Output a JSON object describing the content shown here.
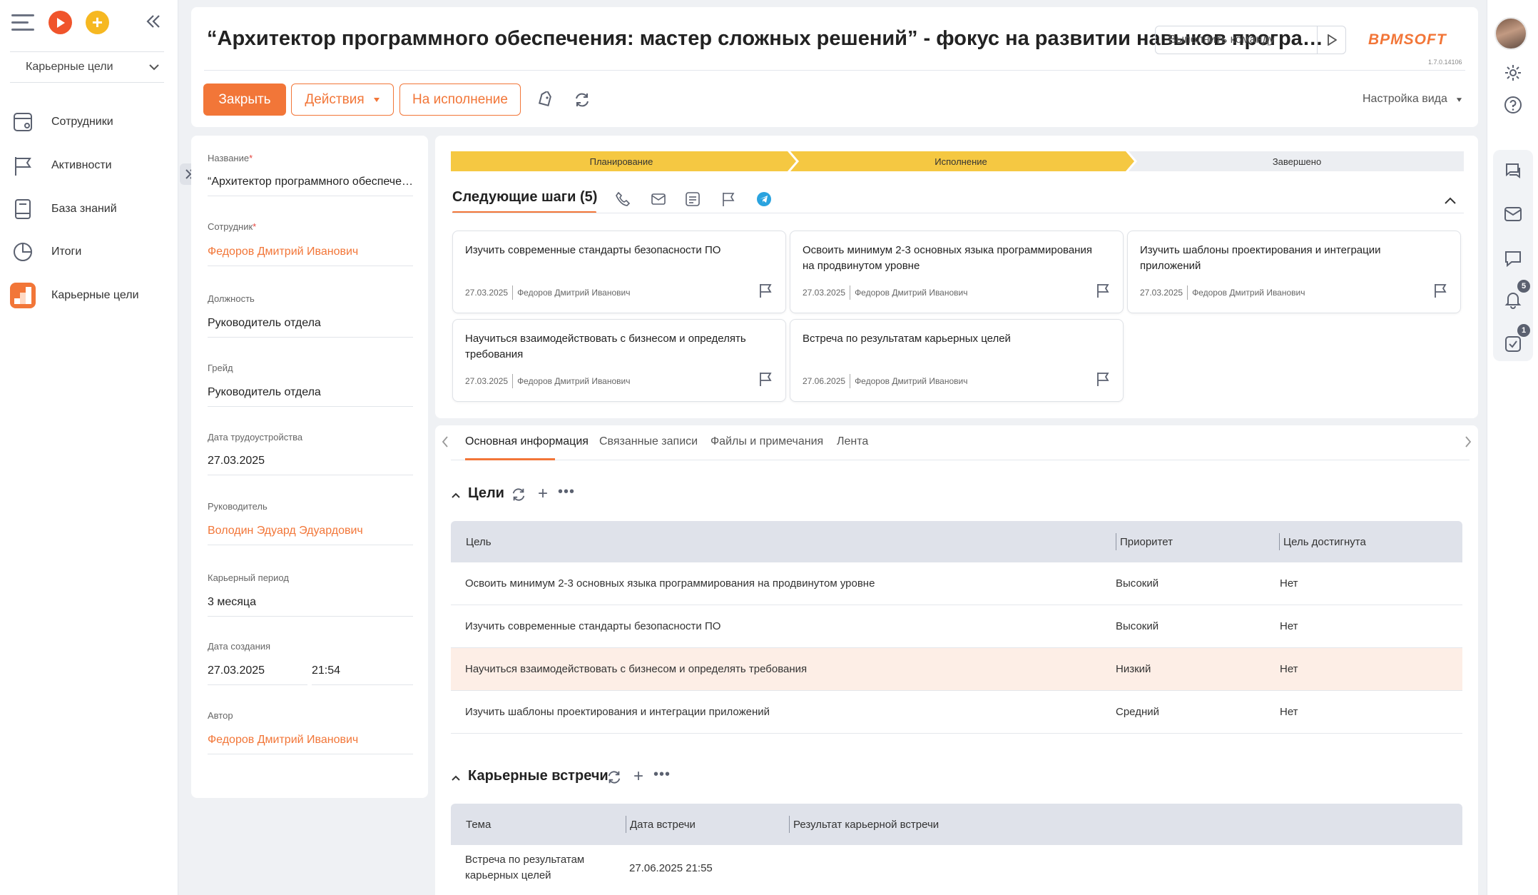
{
  "sidebar": {
    "section_select": "Карьерные цели",
    "items": [
      {
        "label": "Сотрудники",
        "icon": "employee-card-icon"
      },
      {
        "label": "Активности",
        "icon": "flag-icon"
      },
      {
        "label": "База знаний",
        "icon": "book-icon"
      },
      {
        "label": "Итоги",
        "icon": "pie-chart-icon"
      },
      {
        "label": "Карьерные цели",
        "icon": "career-ladder-icon"
      }
    ]
  },
  "header": {
    "title": "“Архитектор программного обеспечения: мастер сложных решений” - фокус на развитии навыков программирования",
    "command_placeholder": "Выполнить команду",
    "logo": "BPMSOFT",
    "version": "1.7.0.14106",
    "close_label": "Закрыть",
    "actions_label": "Действия",
    "execute_label": "На исполнение",
    "view_settings": "Настройка вида"
  },
  "form": {
    "fields": [
      {
        "label": "Название",
        "required": "*",
        "value": "“Архитектор программного обеспечения: мастер сложных решений”",
        "link": false
      },
      {
        "label": "Сотрудник",
        "required": "*",
        "value": "Федоров Дмитрий Иванович",
        "link": true
      },
      {
        "label": "Должность",
        "required": "",
        "value": "Руководитель отдела",
        "link": false
      },
      {
        "label": "Грейд",
        "required": "",
        "value": "Руководитель отдела",
        "link": false
      },
      {
        "label": "Дата трудоустройства",
        "required": "",
        "value": "27.03.2025",
        "link": false
      },
      {
        "label": "Руководитель",
        "required": "",
        "value": "Володин Эдуард Эдуардович",
        "link": true
      },
      {
        "label": "Карьерный период",
        "required": "",
        "value": "3 месяца",
        "link": false
      },
      {
        "label": "Дата создания",
        "required": "",
        "value": "27.03.2025",
        "link": false
      },
      {
        "label": "Автор",
        "required": "",
        "value": "Федоров Дмитрий Иванович",
        "link": true
      }
    ],
    "created_time": "21:54"
  },
  "stages": [
    "Планирование",
    "Исполнение",
    "Завершено"
  ],
  "next_steps": {
    "title": "Следующие шаги (5)",
    "cards": [
      {
        "title": "Изучить современные стандарты безопасности ПО",
        "date": "27.03.2025",
        "owner": "Федоров Дмитрий Иванович"
      },
      {
        "title": "Освоить минимум 2-3 основных языка программирования на продвинутом уровне",
        "date": "27.03.2025",
        "owner": "Федоров Дмитрий Иванович"
      },
      {
        "title": "Изучить шаблоны проектирования и интеграции приложений",
        "date": "27.03.2025",
        "owner": "Федоров Дмитрий Иванович"
      },
      {
        "title": "Научиться взаимодействовать с бизнесом и определять требования",
        "date": "27.03.2025",
        "owner": "Федоров Дмитрий Иванович"
      },
      {
        "title": "Встреча по результатам карьерных целей",
        "date": "27.06.2025",
        "owner": "Федоров Дмитрий Иванович"
      }
    ]
  },
  "tabs": [
    "Основная информация",
    "Связанные записи",
    "Файлы и примечания",
    "Лента"
  ],
  "goals": {
    "title": "Цели",
    "columns": [
      "Цель",
      "Приоритет",
      "Цель достигнута"
    ],
    "rows": [
      [
        "Освоить минимум 2-3 основных языка программирования на продвинутом уровне",
        "Высокий",
        "Нет"
      ],
      [
        "Изучить современные стандарты безопасности ПО",
        "Высокий",
        "Нет"
      ],
      [
        "Научиться взаимодействовать с бизнесом и определять требования",
        "Низкий",
        "Нет"
      ],
      [
        "Изучить шаблоны проектирования и интеграции приложений",
        "Средний",
        "Нет"
      ]
    ]
  },
  "meetings": {
    "title": "Карьерные встречи",
    "columns": [
      "Тема",
      "Дата встречи",
      "Результат карьерной встречи"
    ],
    "rows": [
      [
        "Встреча по результатам карьерных целей",
        "27.06.2025 21:55",
        ""
      ]
    ]
  },
  "right_bar": {
    "notifications_count": "5",
    "tasks_count": "1"
  },
  "colors": {
    "accent": "#f27638",
    "stage_active": "#f5c842",
    "stage_idle": "#eceef2"
  }
}
